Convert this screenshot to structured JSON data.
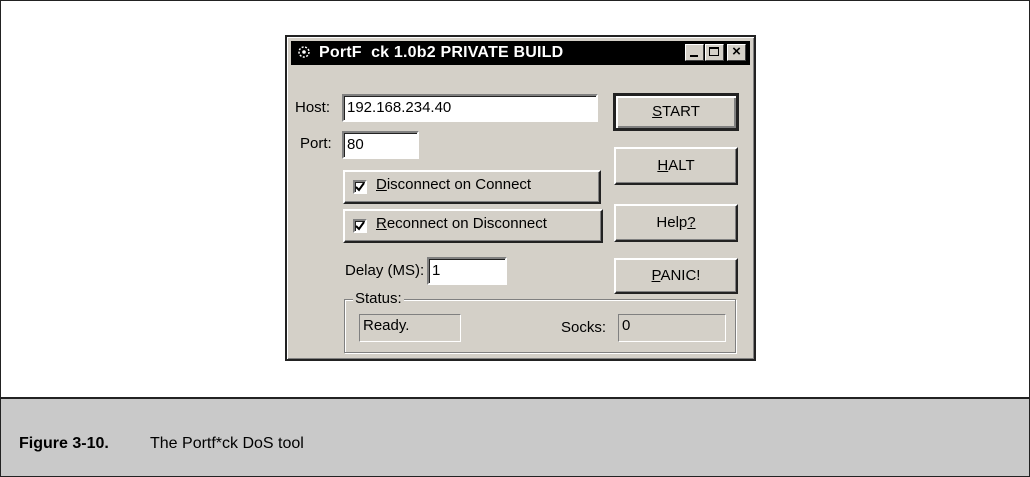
{
  "window": {
    "title": "PortF  ck 1.0b2 PRIVATE BUILD",
    "icon": "portfuck-app-icon",
    "controls": {
      "minimize": "minimize-icon",
      "maximize": "maximize-icon",
      "close": "close-icon"
    }
  },
  "form": {
    "host_label": "Host:",
    "host_value": "192.168.234.40",
    "port_label": "Port:",
    "port_value": "80",
    "disconnect_checkbox": {
      "checked": true,
      "label_access": "D",
      "label_rest": "isconnect on Connect"
    },
    "reconnect_checkbox": {
      "checked": true,
      "label_access": "R",
      "label_rest": "econnect on Disconnect"
    },
    "delay_label": "Delay (MS):",
    "delay_value": "1"
  },
  "buttons": {
    "start": {
      "access": "S",
      "rest": "TART"
    },
    "halt": {
      "access": "H",
      "rest": "ALT"
    },
    "help": {
      "pre": "Help",
      "access": "?"
    },
    "panic": {
      "access": "P",
      "rest": "ANIC!"
    }
  },
  "status": {
    "group_label": "Status:",
    "status_value": "Ready.",
    "socks_label": "Socks:",
    "socks_value": "0"
  },
  "caption": {
    "number": "Figure 3-10.",
    "text": "The Portf*ck DoS tool"
  },
  "colors": {
    "window_face": "#d4d0c8",
    "title_bar": "#000000",
    "caption_bar": "#c9c9c9"
  }
}
